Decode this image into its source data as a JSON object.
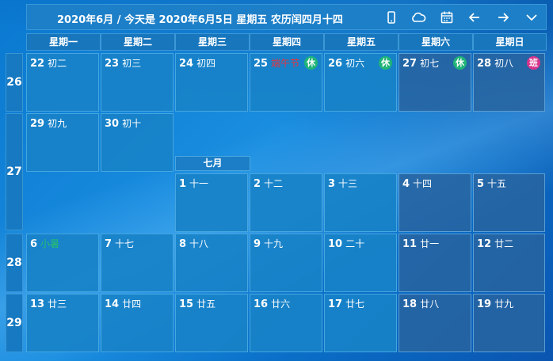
{
  "toolbar": {
    "title": "2020年6月 / 今天是 2020年6月5日 星期五 农历闰四月十四",
    "icons": [
      "phone-icon",
      "cloud-icon",
      "calendar-icon",
      "arrow-left-icon",
      "arrow-right-icon",
      "chevron-down-icon"
    ]
  },
  "weekdays": [
    "星期一",
    "星期二",
    "星期三",
    "星期四",
    "星期五",
    "星期六",
    "星期日"
  ],
  "week_numbers": [
    "26",
    "27",
    "28",
    "29"
  ],
  "month_tag": "七月",
  "days": [
    {
      "d": "22",
      "l": "初二"
    },
    {
      "d": "23",
      "l": "初三"
    },
    {
      "d": "24",
      "l": "初四"
    },
    {
      "d": "25",
      "l": "端午节",
      "red": true,
      "badge": "休"
    },
    {
      "d": "26",
      "l": "初六",
      "badge": "休"
    },
    {
      "d": "27",
      "l": "初七",
      "badge": "休"
    },
    {
      "d": "28",
      "l": "初八",
      "badge": "班"
    },
    {
      "d": "29",
      "l": "初九"
    },
    {
      "d": "30",
      "l": "初十"
    },
    {
      "d": "1",
      "l": "十一"
    },
    {
      "d": "2",
      "l": "十二"
    },
    {
      "d": "3",
      "l": "十三"
    },
    {
      "d": "4",
      "l": "十四"
    },
    {
      "d": "5",
      "l": "十五"
    },
    {
      "d": "6",
      "l": "小暑",
      "green": true
    },
    {
      "d": "7",
      "l": "十七"
    },
    {
      "d": "8",
      "l": "十八"
    },
    {
      "d": "9",
      "l": "十九"
    },
    {
      "d": "10",
      "l": "二十"
    },
    {
      "d": "11",
      "l": "廿一"
    },
    {
      "d": "12",
      "l": "廿二"
    },
    {
      "d": "13",
      "l": "廿三"
    },
    {
      "d": "14",
      "l": "廿四"
    },
    {
      "d": "15",
      "l": "廿五"
    },
    {
      "d": "16",
      "l": "廿六"
    },
    {
      "d": "17",
      "l": "廿七"
    },
    {
      "d": "18",
      "l": "廿八"
    },
    {
      "d": "19",
      "l": "廿九"
    }
  ]
}
